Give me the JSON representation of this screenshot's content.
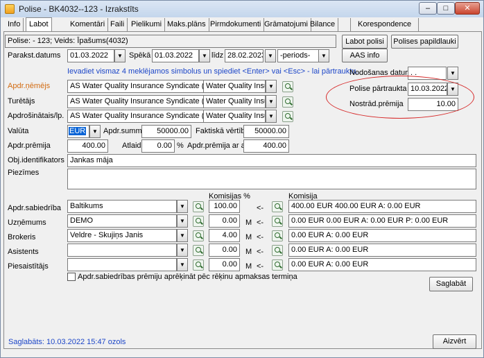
{
  "window": {
    "title": "Polise - BK4032--123 - Izrakstīts",
    "min_glyph": "–",
    "max_glyph": "□",
    "close_glyph": "✕"
  },
  "tabs": [
    "Info",
    "Labot",
    "Komentāri",
    "Faili",
    "Pielikumi",
    "Maks.plāns",
    "Pirmdokumenti",
    "Grāmatojumi",
    "Bilance",
    "Korespondence"
  ],
  "policy_header": "Polise: - 123; Veids: Īpašums(4032)",
  "buttons": {
    "labot_polisi": "Labot polisi",
    "polises_papildlauki": "Polises papildlauki",
    "aas_info": "AAS info",
    "saglabat": "Saglabāt",
    "aizvert": "Aizvērt"
  },
  "dates": {
    "label_parakst": "Parakst.datums",
    "parakst_value": "01.03.2022",
    "label_speka": "Spēkā no",
    "speka_value": "01.03.2022",
    "label_lidz": "līdz",
    "lidz_value": "28.02.2023",
    "periods_value": "-periods-"
  },
  "hint_text": "Ievadiet  vismaz 4 meklējamos simbolus un spiediet <Enter> vai <Esc> - lai pārtrauktu.",
  "right_panel": {
    "nodosanas_label": "Nodošanas datums",
    "nodosanas_value": ". .",
    "partraukta_label": "Polise pārtraukta",
    "partraukta_value": "10.03.2022",
    "nostrad_label": "Nostrād.prēmija",
    "nostrad_value": "10.00"
  },
  "parties": {
    "apdr_label": "Apdr.ņēmējs",
    "apdr_left": "AS Water Quality Insurance Syndicate (11111",
    "apdr_right": "Water Quality Insurar",
    "tur_label": "Turētājs",
    "tur_left": "AS Water Quality Insurance Syndicate (11111",
    "tur_right": "Water Quality Insurar",
    "ins_label": "Apdrošinātais/lp.",
    "ins_left": "AS Water Quality Insurance Syndicate (11111",
    "ins_right": "Water Quality Insurar"
  },
  "finance": {
    "valuta_label": "Valūta",
    "valuta_value": "EUR",
    "summa_label": "Apdr.summa",
    "summa_value": "50000.00",
    "faktiska_label": "Faktiskā vērtība",
    "faktiska_value": "50000.00",
    "premija_label": "Apdr.prēmija",
    "premija_value": "400.00",
    "atlaide_label": "Atlaide",
    "atlaide_value": "0.00",
    "percent_sign": "%",
    "premija_atl_label": "Apdr.prēmija ar atl.",
    "premija_atl_value": "400.00"
  },
  "obj_label": "Obj.identifikators",
  "obj_value": "Jankas māja",
  "piezimes_label": "Piezīmes",
  "comm_headers": {
    "komisijas": "Komisijas %",
    "komisija": "Komisija"
  },
  "commission_rows": [
    {
      "label": "Apdr.sabiedrība",
      "name": "Baltikums",
      "pct": "100.00",
      "m": "",
      "arrow": "<-",
      "summary": "400.00 EUR 400.00 EUR A: 0.00 EUR"
    },
    {
      "label": "Uzņēmums",
      "name": "DEMO",
      "pct": "0.00",
      "m": "M",
      "arrow": "<-",
      "summary": "0.00 EUR 0.00 EUR A: 0.00 EUR P: 0.00 EUR"
    },
    {
      "label": "Brokeris",
      "name": "Veldre - Skujiņs Janis",
      "pct": "4.00",
      "m": "M",
      "arrow": "<-",
      "summary": "0.00 EUR A: 0.00 EUR"
    },
    {
      "label": "Asistents",
      "name": "",
      "pct": "0.00",
      "m": "M",
      "arrow": "<-",
      "summary": "0.00 EUR A: 0.00 EUR"
    },
    {
      "label": "Piesaistītājs",
      "name": "",
      "pct": "0.00",
      "m": "M",
      "arrow": "<-",
      "summary": "0.00 EUR A: 0.00 EUR"
    }
  ],
  "checkbox_label": "Apdr.sabiedrības prēmiju aprēķināt pēc rēķinu apmaksas termiņa",
  "status_text": "Saglabāts: 10.03.2022 15:47 ozols",
  "colors": {
    "accent_blue": "#1c46c8",
    "label_orange": "#d26a10",
    "highlight_red": "#d62828"
  }
}
